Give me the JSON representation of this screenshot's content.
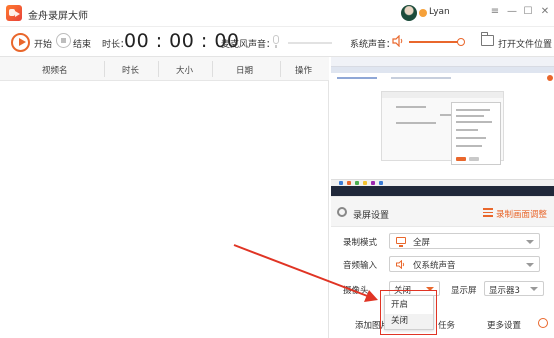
{
  "app": {
    "title": "金舟录屏大师"
  },
  "user": {
    "name": "Lyan"
  },
  "toolbar": {
    "start_label": "开始",
    "stop_label": "结束",
    "duration_label": "时长：",
    "duration_value": "00 : 00 : 00",
    "mic_label": "麦克风声音：",
    "system_label": "系统声音：",
    "open_folder_label": "打开文件位置"
  },
  "file_list": {
    "columns": [
      "视频名",
      "时长",
      "大小",
      "日期",
      "操作"
    ]
  },
  "settings": {
    "title": "录屏设置",
    "adjust_link": "录制画面调整",
    "record_mode_label": "录制模式",
    "record_mode_value": "全屏",
    "audio_input_label": "音频输入",
    "audio_input_value": "仅系统声音",
    "camera_label": "摄像头",
    "camera_value": "关闭",
    "display_label": "显示屏",
    "display_value": "显示器3",
    "camera_options": [
      "开启",
      "关闭"
    ],
    "add_picture_label": "添加图片",
    "task_label": "任务",
    "more_settings_label": "更多设置"
  },
  "colors": {
    "accent": "#e9672c",
    "annotation_red": "#e03424"
  }
}
